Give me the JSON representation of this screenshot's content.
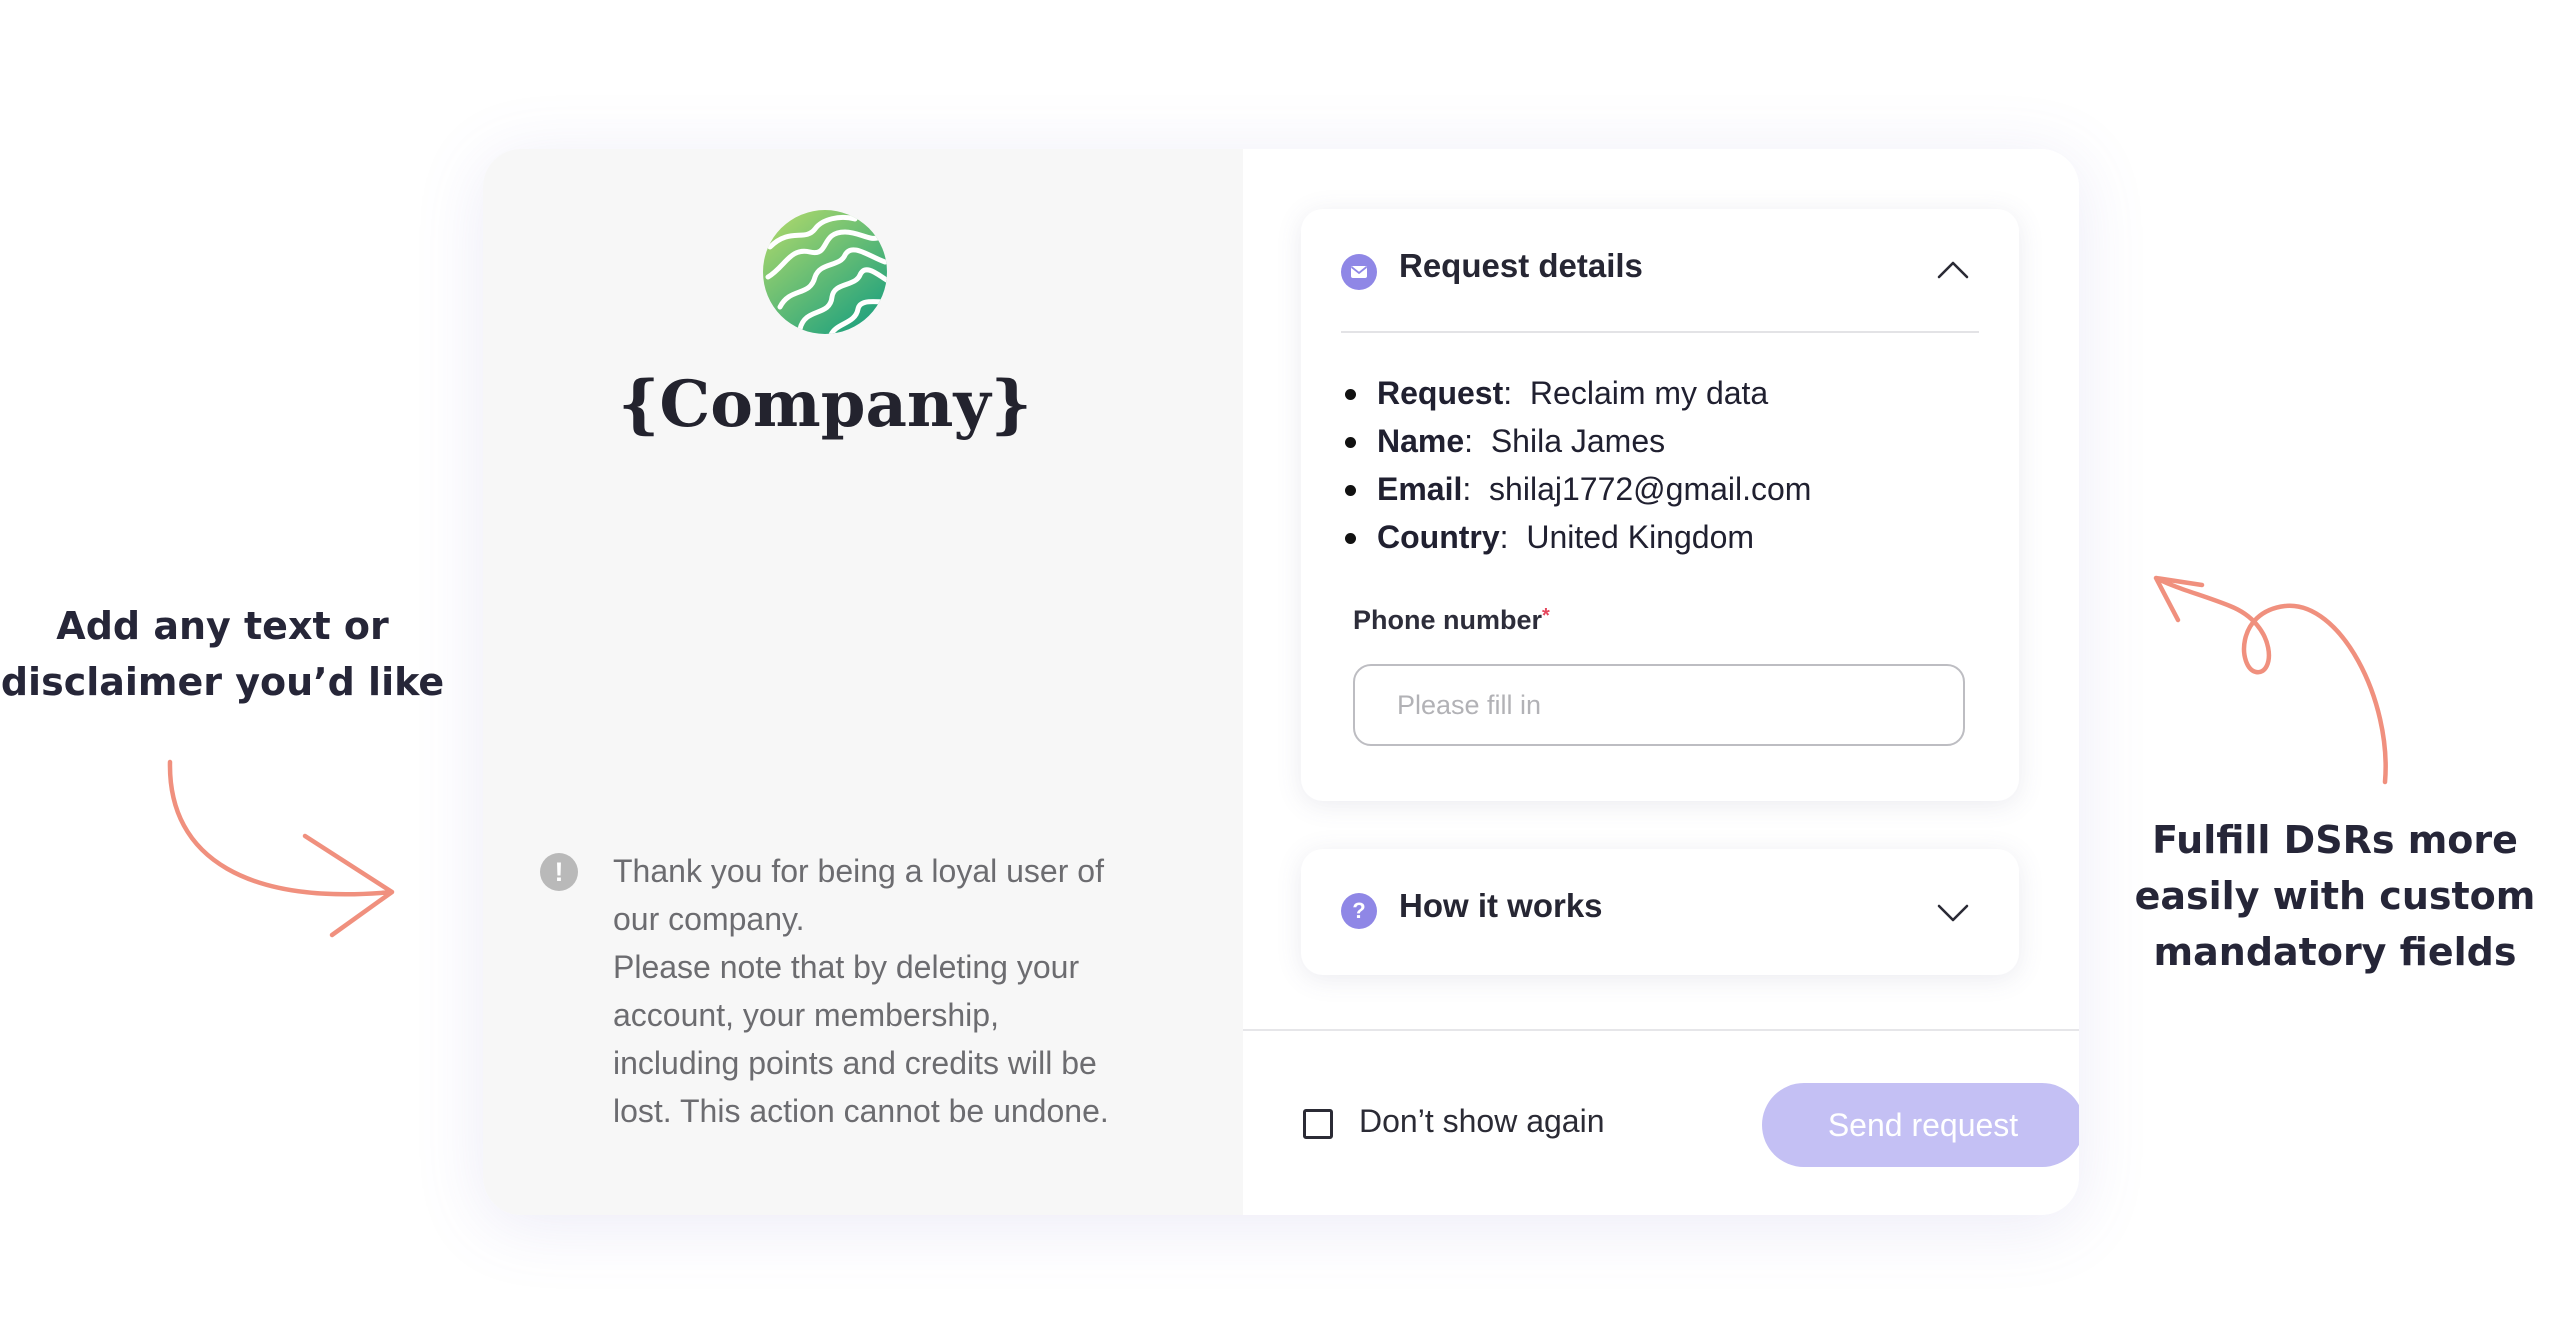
{
  "annotations": {
    "left_caption_lines": [
      "Add any text or",
      "disclaimer you’d like"
    ],
    "right_caption_lines": [
      "Fulfill DSRs more",
      "easily with custom",
      "mandatory fields"
    ],
    "arrow_color": "#f0907e"
  },
  "brand": {
    "company_name": "{Company}",
    "logo_icon": "swirl-globe-logo",
    "logo_gradient": [
      "#b7dc6a",
      "#1ea17e"
    ]
  },
  "disclaimer": {
    "icon": "exclamation-icon",
    "lines": [
      "Thank you for being a loyal user of",
      "our company.",
      "Please note that by deleting your",
      "account, your membership,",
      "including points and credits will be",
      "lost. This action cannot be undone."
    ]
  },
  "request_panel": {
    "icon": "envelope-icon",
    "title": "Request details",
    "expanded": true,
    "details": [
      {
        "label": "Request",
        "value": "Reclaim my data"
      },
      {
        "label": "Name",
        "value": "Shila James"
      },
      {
        "label": "Email",
        "value": "shilaj1772@gmail.com"
      },
      {
        "label": "Country",
        "value": "United Kingdom"
      }
    ],
    "phone_field": {
      "label": "Phone number",
      "required_mark": "*",
      "value": "",
      "placeholder": "Please fill in"
    }
  },
  "how_panel": {
    "icon": "question-icon",
    "title": "How it works",
    "expanded": false
  },
  "footer": {
    "checkbox_label": "Don’t show again",
    "checkbox_checked": false,
    "send_label": "Send request",
    "send_enabled": false
  },
  "colors": {
    "accent": "#8f87e6",
    "button_disabled": "#c4c0f4",
    "required": "#e5465c"
  }
}
